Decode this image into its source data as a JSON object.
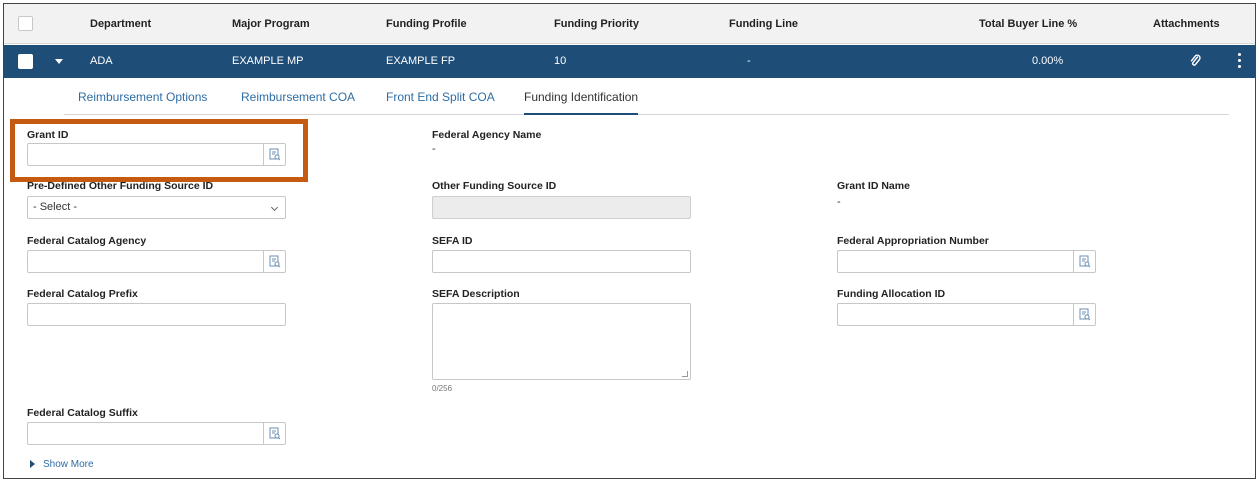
{
  "table": {
    "headers": [
      "Department",
      "Major Program",
      "Funding Profile",
      "Funding Priority",
      "Funding Line",
      "Total Buyer Line %",
      "Attachments"
    ],
    "row": {
      "department": "ADA",
      "major_program": "EXAMPLE MP",
      "funding_profile": "EXAMPLE FP",
      "funding_priority": "10",
      "funding_line": "-",
      "total_buyer_line_pct": "0.00%"
    }
  },
  "tabs": [
    {
      "label": "Reimbursement Options"
    },
    {
      "label": "Reimbursement COA"
    },
    {
      "label": "Front End Split COA"
    },
    {
      "label": "Funding Identification",
      "active": true
    }
  ],
  "fields": {
    "grant_id": {
      "label": "Grant ID",
      "value": ""
    },
    "federal_agency_name": {
      "label": "Federal Agency Name",
      "value": "-"
    },
    "predefined_other_funding_source_id": {
      "label": "Pre-Defined Other Funding Source ID",
      "selected": "- Select -"
    },
    "other_funding_source_id": {
      "label": "Other Funding Source ID",
      "value": ""
    },
    "grant_id_name": {
      "label": "Grant ID Name",
      "value": "-"
    },
    "federal_catalog_agency": {
      "label": "Federal Catalog Agency",
      "value": ""
    },
    "sefa_id": {
      "label": "SEFA ID",
      "value": ""
    },
    "federal_appropriation_number": {
      "label": "Federal Appropriation Number",
      "value": ""
    },
    "federal_catalog_prefix": {
      "label": "Federal Catalog Prefix",
      "value": ""
    },
    "sefa_description": {
      "label": "SEFA Description",
      "value": "",
      "counter": "0/256"
    },
    "funding_allocation_id": {
      "label": "Funding Allocation ID",
      "value": ""
    },
    "federal_catalog_suffix": {
      "label": "Federal Catalog Suffix",
      "value": ""
    }
  },
  "show_more": {
    "label": "Show More"
  },
  "colors": {
    "row_bg": "#1e4d78",
    "tab_link": "#2e6da4",
    "highlight": "#c55a11",
    "header_bg": "#f2f2f2"
  },
  "icons": {
    "lookup": "lookup-icon",
    "expand": "caret-down-icon",
    "attachment": "paperclip-icon",
    "more": "kebab-icon"
  }
}
